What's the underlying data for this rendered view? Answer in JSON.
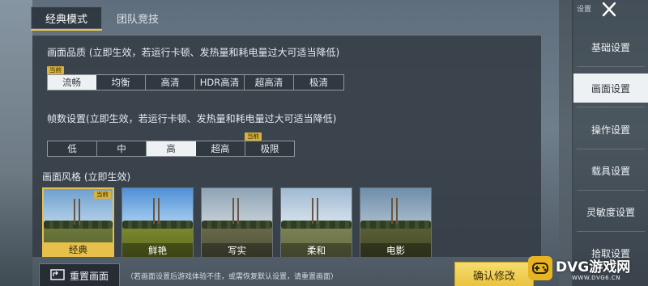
{
  "tabs": [
    {
      "label": "经典模式",
      "active": true
    },
    {
      "label": "团队竞技",
      "active": false
    }
  ],
  "quality": {
    "title": "画面品质 (立即生效，若运行卡顿、发热量和耗电量过大可适当降低)",
    "badge": "当前",
    "options": [
      "流畅",
      "均衡",
      "高清",
      "HDR高清",
      "超高清",
      "极清"
    ],
    "selected": "流畅"
  },
  "framerate": {
    "title": "帧数设置(立即生效，若运行卡顿、发热量和耗电量过大可适当降低)",
    "badge": "当前",
    "options": [
      "低",
      "中",
      "高",
      "超高",
      "极限"
    ],
    "selected": "高"
  },
  "style": {
    "title": "画面风格 (立即生效)",
    "badge": "当前",
    "cards": [
      "经典",
      "鲜艳",
      "写实",
      "柔和",
      "电影"
    ],
    "selected": "经典"
  },
  "sidebar": {
    "header": "设置",
    "items": [
      {
        "label": "基础设置",
        "active": false
      },
      {
        "label": "画面设置",
        "active": true
      },
      {
        "label": "操作设置",
        "active": false
      },
      {
        "label": "载具设置",
        "active": false
      },
      {
        "label": "灵敏度设置",
        "active": false
      },
      {
        "label": "拾取设置",
        "active": false
      }
    ]
  },
  "footer": {
    "reset_label": "重置画面",
    "hint": "（若画面设置后游戏体验不佳，或需恢复默认设置，请重置画面）",
    "confirm_label": "确认修改"
  },
  "watermark": {
    "name": "DVG游戏网",
    "url": "WWW.DVG6.CN"
  },
  "colors": {
    "accent": "#e6c04a",
    "panel": "#343c44",
    "selected_option": "#eef1f3"
  },
  "icons": [
    "close-icon",
    "reset-screen-icon",
    "gamepad-logo-icon"
  ]
}
